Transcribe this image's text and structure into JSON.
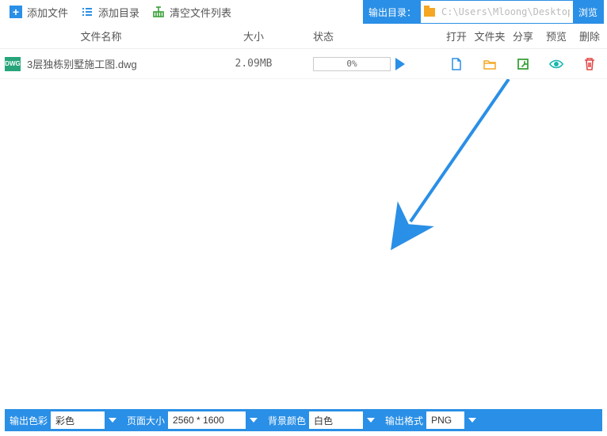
{
  "toolbar": {
    "add_file": "添加文件",
    "add_dir": "添加目录",
    "clear_list": "清空文件列表"
  },
  "outdir": {
    "label": "输出目录：",
    "path": "C:\\Users\\Mloong\\Desktop",
    "browse": "浏览"
  },
  "columns": {
    "name": "文件名称",
    "size": "大小",
    "status": "状态",
    "open": "打开",
    "folder": "文件夹",
    "share": "分享",
    "preview": "预览",
    "delete": "删除"
  },
  "files": [
    {
      "icon": "DWG",
      "name": "3层独栋别墅施工图.dwg",
      "size": "2.09MB",
      "progress": "0%"
    }
  ],
  "bottom": {
    "color_label": "输出色彩",
    "color_value": "彩色",
    "size_label": "页面大小",
    "size_value": "2560 * 1600",
    "bg_label": "背景颜色",
    "bg_value": "白色",
    "fmt_label": "输出格式",
    "fmt_value": "PNG"
  }
}
